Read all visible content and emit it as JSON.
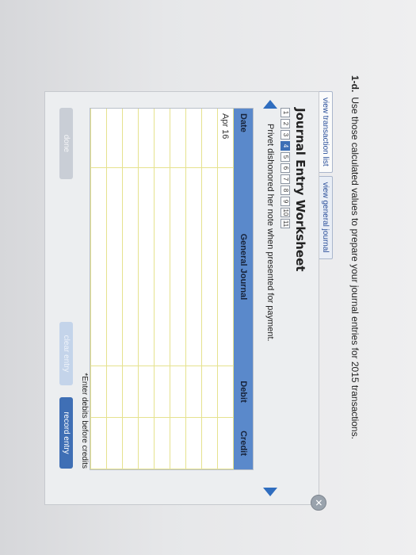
{
  "question": {
    "number": "1-d.",
    "text": "Use those calculated values to prepare your journal entries for 2015 transactions."
  },
  "tabs": [
    "view transaction list",
    "view general journal"
  ],
  "worksheet": {
    "title": "Journal Entry Worksheet",
    "pages": [
      "1",
      "2",
      "3",
      "4",
      "5",
      "6",
      "7",
      "8",
      "9",
      "10",
      "11"
    ],
    "current_page": "4",
    "description": "Privet dishonored her note when presented for payment."
  },
  "grid": {
    "headers": {
      "date": "Date",
      "journal": "General Journal",
      "debit": "Debit",
      "credit": "Credit"
    },
    "rows": [
      {
        "date": "Apr 16",
        "account": "",
        "debit": "",
        "credit": ""
      },
      {
        "date": "",
        "account": "",
        "debit": "",
        "credit": ""
      },
      {
        "date": "",
        "account": "",
        "debit": "",
        "credit": ""
      },
      {
        "date": "",
        "account": "",
        "debit": "",
        "credit": ""
      },
      {
        "date": "",
        "account": "",
        "debit": "",
        "credit": ""
      },
      {
        "date": "",
        "account": "",
        "debit": "",
        "credit": ""
      },
      {
        "date": "",
        "account": "",
        "debit": "",
        "credit": ""
      },
      {
        "date": "",
        "account": "",
        "debit": "",
        "credit": ""
      },
      {
        "date": "",
        "account": "",
        "debit": "",
        "credit": ""
      }
    ]
  },
  "note": "*Enter debits before credits",
  "buttons": {
    "done": "done",
    "clear": "clear entry",
    "record": "record entry"
  },
  "icons": {
    "close": "close-icon",
    "prev": "prev-arrow-icon",
    "next": "next-arrow-icon"
  }
}
